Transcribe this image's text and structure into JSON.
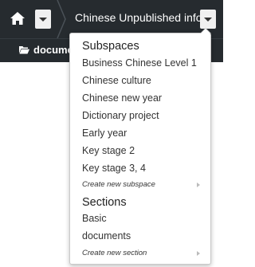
{
  "topbar": {
    "home_icon": "home-icon",
    "title": "Chinese Unpublished info"
  },
  "subbar": {
    "folder_icon": "folder-open-icon",
    "folder_label": "docume"
  },
  "dropdown": {
    "subspaces_header": "Subspaces",
    "subspaces": [
      "Business Chinese Level 1",
      "Chinese culture",
      "Chinese new year",
      "Dictionary project",
      "Early year",
      "Key stage 2",
      "Key stage 3, 4"
    ],
    "create_subspace": "Create new subspace",
    "sections_header": "Sections",
    "sections": [
      "Basic",
      "documents"
    ],
    "create_section": "Create new section"
  }
}
